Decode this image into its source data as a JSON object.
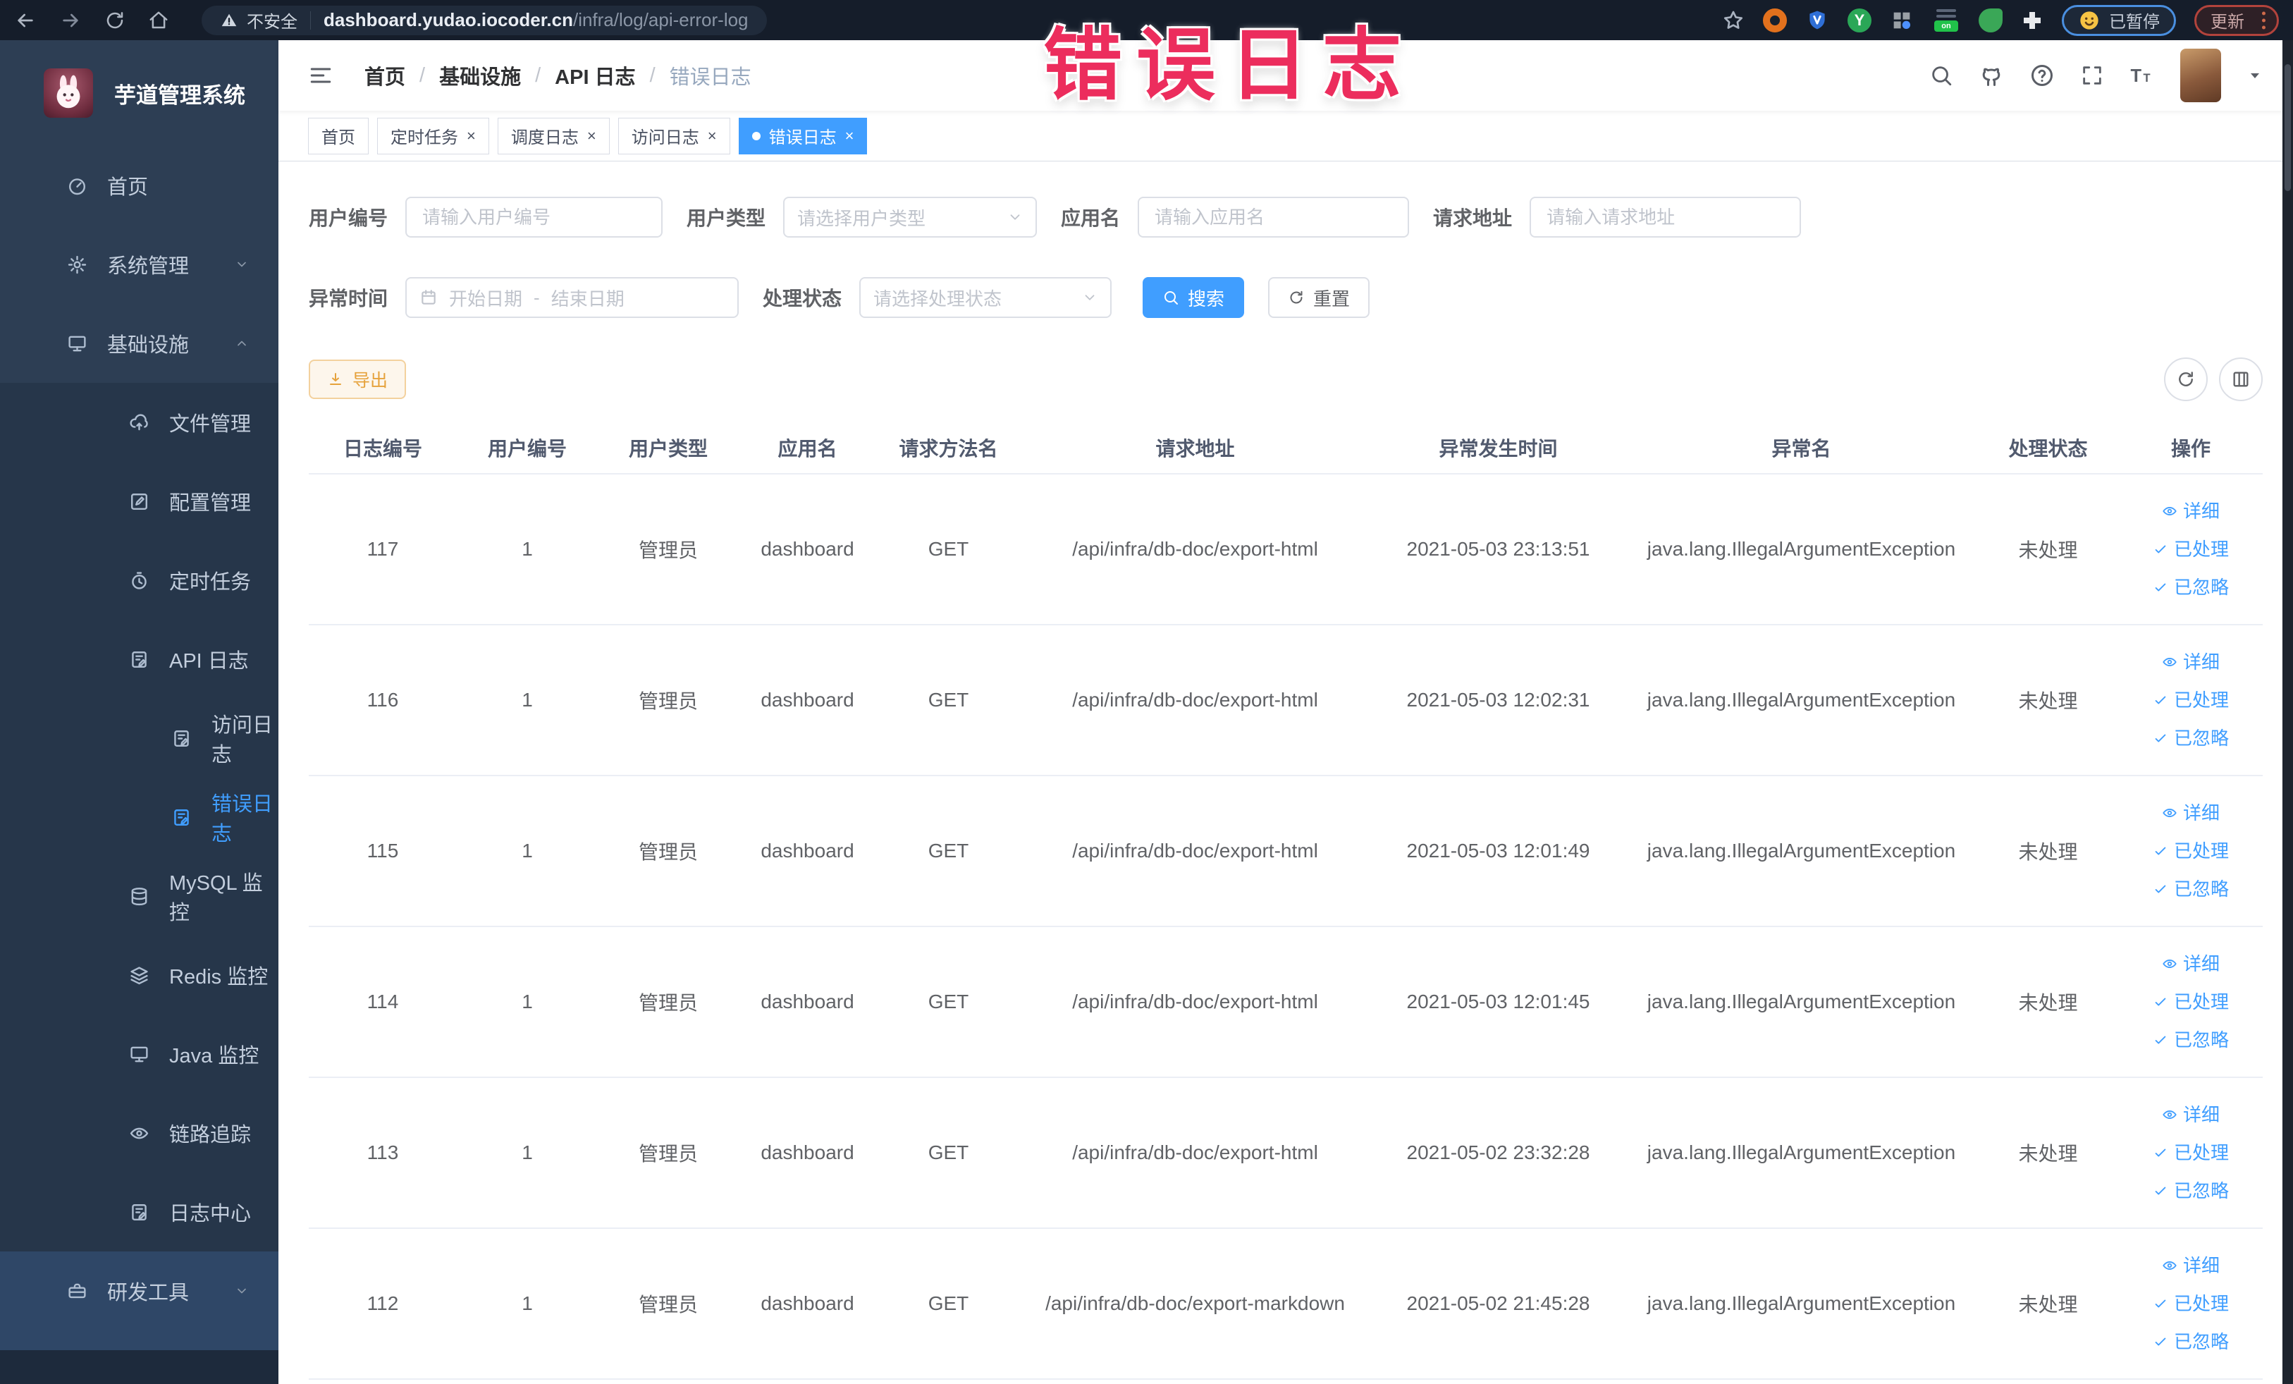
{
  "browser": {
    "security_label": "不安全",
    "url_host": "dashboard.yudao.iocoder.cn",
    "url_path": "/infra/log/api-error-log",
    "paused_badge_label": "已暂停",
    "update_badge_label": "更新"
  },
  "annotation": {
    "text": "错误日志",
    "color": "#ec2d5d"
  },
  "sidebar": {
    "logo_title": "芋道管理系统",
    "menu": [
      {
        "key": "home",
        "label": "首页",
        "icon": "dashboard-icon",
        "level": 1
      },
      {
        "key": "system-mgmt",
        "label": "系统管理",
        "icon": "gear-icon",
        "level": 1,
        "chevron": "down"
      },
      {
        "key": "infrastructure",
        "label": "基础设施",
        "icon": "monitor-icon",
        "level": 1,
        "chevron": "up"
      },
      {
        "key": "file-mgmt",
        "label": "文件管理",
        "icon": "cloud-upload-icon",
        "level": 2
      },
      {
        "key": "config-mgmt",
        "label": "配置管理",
        "icon": "edit-icon",
        "level": 2
      },
      {
        "key": "cron-job",
        "label": "定时任务",
        "icon": "timer-icon",
        "level": 2
      },
      {
        "key": "api-log",
        "label": "API 日志",
        "icon": "doc-pen-icon",
        "level": 2,
        "chevron": "up"
      },
      {
        "key": "access-log",
        "label": "访问日志",
        "icon": "doc-pen-icon",
        "level": 3
      },
      {
        "key": "error-log",
        "label": "错误日志",
        "icon": "doc-pen-icon",
        "level": 3,
        "active": true
      },
      {
        "key": "mysql-monitor",
        "label": "MySQL 监控",
        "icon": "database-icon",
        "level": 2
      },
      {
        "key": "redis-monitor",
        "label": "Redis 监控",
        "icon": "stack-icon",
        "level": 2
      },
      {
        "key": "java-monitor",
        "label": "Java 监控",
        "icon": "monitor-icon",
        "level": 2
      },
      {
        "key": "trace",
        "label": "链路追踪",
        "icon": "eye-icon",
        "level": 2
      },
      {
        "key": "log-center",
        "label": "日志中心",
        "icon": "doc-pen-icon",
        "level": 2
      },
      {
        "key": "dev-tools",
        "label": "研发工具",
        "icon": "toolbox-icon",
        "level": 1,
        "chevron": "down",
        "bottom": true
      }
    ]
  },
  "navbar": {
    "breadcrumb": [
      "首页",
      "基础设施",
      "API 日志",
      "错误日志"
    ]
  },
  "tabs": [
    {
      "key": "home",
      "label": "首页",
      "closable": false,
      "active": false
    },
    {
      "key": "cron-job",
      "label": "定时任务",
      "closable": true,
      "active": false
    },
    {
      "key": "job-log",
      "label": "调度日志",
      "closable": true,
      "active": false
    },
    {
      "key": "access-log",
      "label": "访问日志",
      "closable": true,
      "active": false
    },
    {
      "key": "error-log",
      "label": "错误日志",
      "closable": true,
      "active": true
    }
  ],
  "filters": {
    "user_id": {
      "label": "用户编号",
      "placeholder": "请输入用户编号"
    },
    "user_type": {
      "label": "用户类型",
      "placeholder": "请选择用户类型"
    },
    "app_name": {
      "label": "应用名",
      "placeholder": "请输入应用名"
    },
    "request_url": {
      "label": "请求地址",
      "placeholder": "请输入请求地址"
    },
    "exception_time": {
      "label": "异常时间",
      "start_placeholder": "开始日期",
      "separator": "-",
      "end_placeholder": "结束日期"
    },
    "process_status": {
      "label": "处理状态",
      "placeholder": "请选择处理状态"
    }
  },
  "actions": {
    "search": "搜索",
    "reset": "重置",
    "export": "导出"
  },
  "table": {
    "headers": [
      "日志编号",
      "用户编号",
      "用户类型",
      "应用名",
      "请求方法名",
      "请求地址",
      "异常发生时间",
      "异常名",
      "处理状态",
      "操作"
    ],
    "op_labels": [
      "详细",
      "已处理",
      "已忽略"
    ],
    "rows": [
      {
        "id": "117",
        "user_id": "1",
        "user_type": "管理员",
        "app": "dashboard",
        "method": "GET",
        "url": "/api/infra/db-doc/export-html",
        "time": "2021-05-03 23:13:51",
        "exception": "java.lang.IllegalArgumentException",
        "status": "未处理"
      },
      {
        "id": "116",
        "user_id": "1",
        "user_type": "管理员",
        "app": "dashboard",
        "method": "GET",
        "url": "/api/infra/db-doc/export-html",
        "time": "2021-05-03 12:02:31",
        "exception": "java.lang.IllegalArgumentException",
        "status": "未处理"
      },
      {
        "id": "115",
        "user_id": "1",
        "user_type": "管理员",
        "app": "dashboard",
        "method": "GET",
        "url": "/api/infra/db-doc/export-html",
        "time": "2021-05-03 12:01:49",
        "exception": "java.lang.IllegalArgumentException",
        "status": "未处理"
      },
      {
        "id": "114",
        "user_id": "1",
        "user_type": "管理员",
        "app": "dashboard",
        "method": "GET",
        "url": "/api/infra/db-doc/export-html",
        "time": "2021-05-03 12:01:45",
        "exception": "java.lang.IllegalArgumentException",
        "status": "未处理"
      },
      {
        "id": "113",
        "user_id": "1",
        "user_type": "管理员",
        "app": "dashboard",
        "method": "GET",
        "url": "/api/infra/db-doc/export-html",
        "time": "2021-05-02 23:32:28",
        "exception": "java.lang.IllegalArgumentException",
        "status": "未处理"
      },
      {
        "id": "112",
        "user_id": "1",
        "user_type": "管理员",
        "app": "dashboard",
        "method": "GET",
        "url": "/api/infra/db-doc/export-markdown",
        "time": "2021-05-02 21:45:28",
        "exception": "java.lang.IllegalArgumentException",
        "status": "未处理"
      }
    ]
  },
  "colors": {
    "accent": "#409eff",
    "sidebar_bg": "#2d3e54",
    "submenu_bg": "#26364a",
    "sidebar_bottom_bg": "#2f4767",
    "chrome_bg": "#151d2a",
    "annotation_red": "#ec2d5d",
    "warning_button_text": "#e6a23c"
  }
}
